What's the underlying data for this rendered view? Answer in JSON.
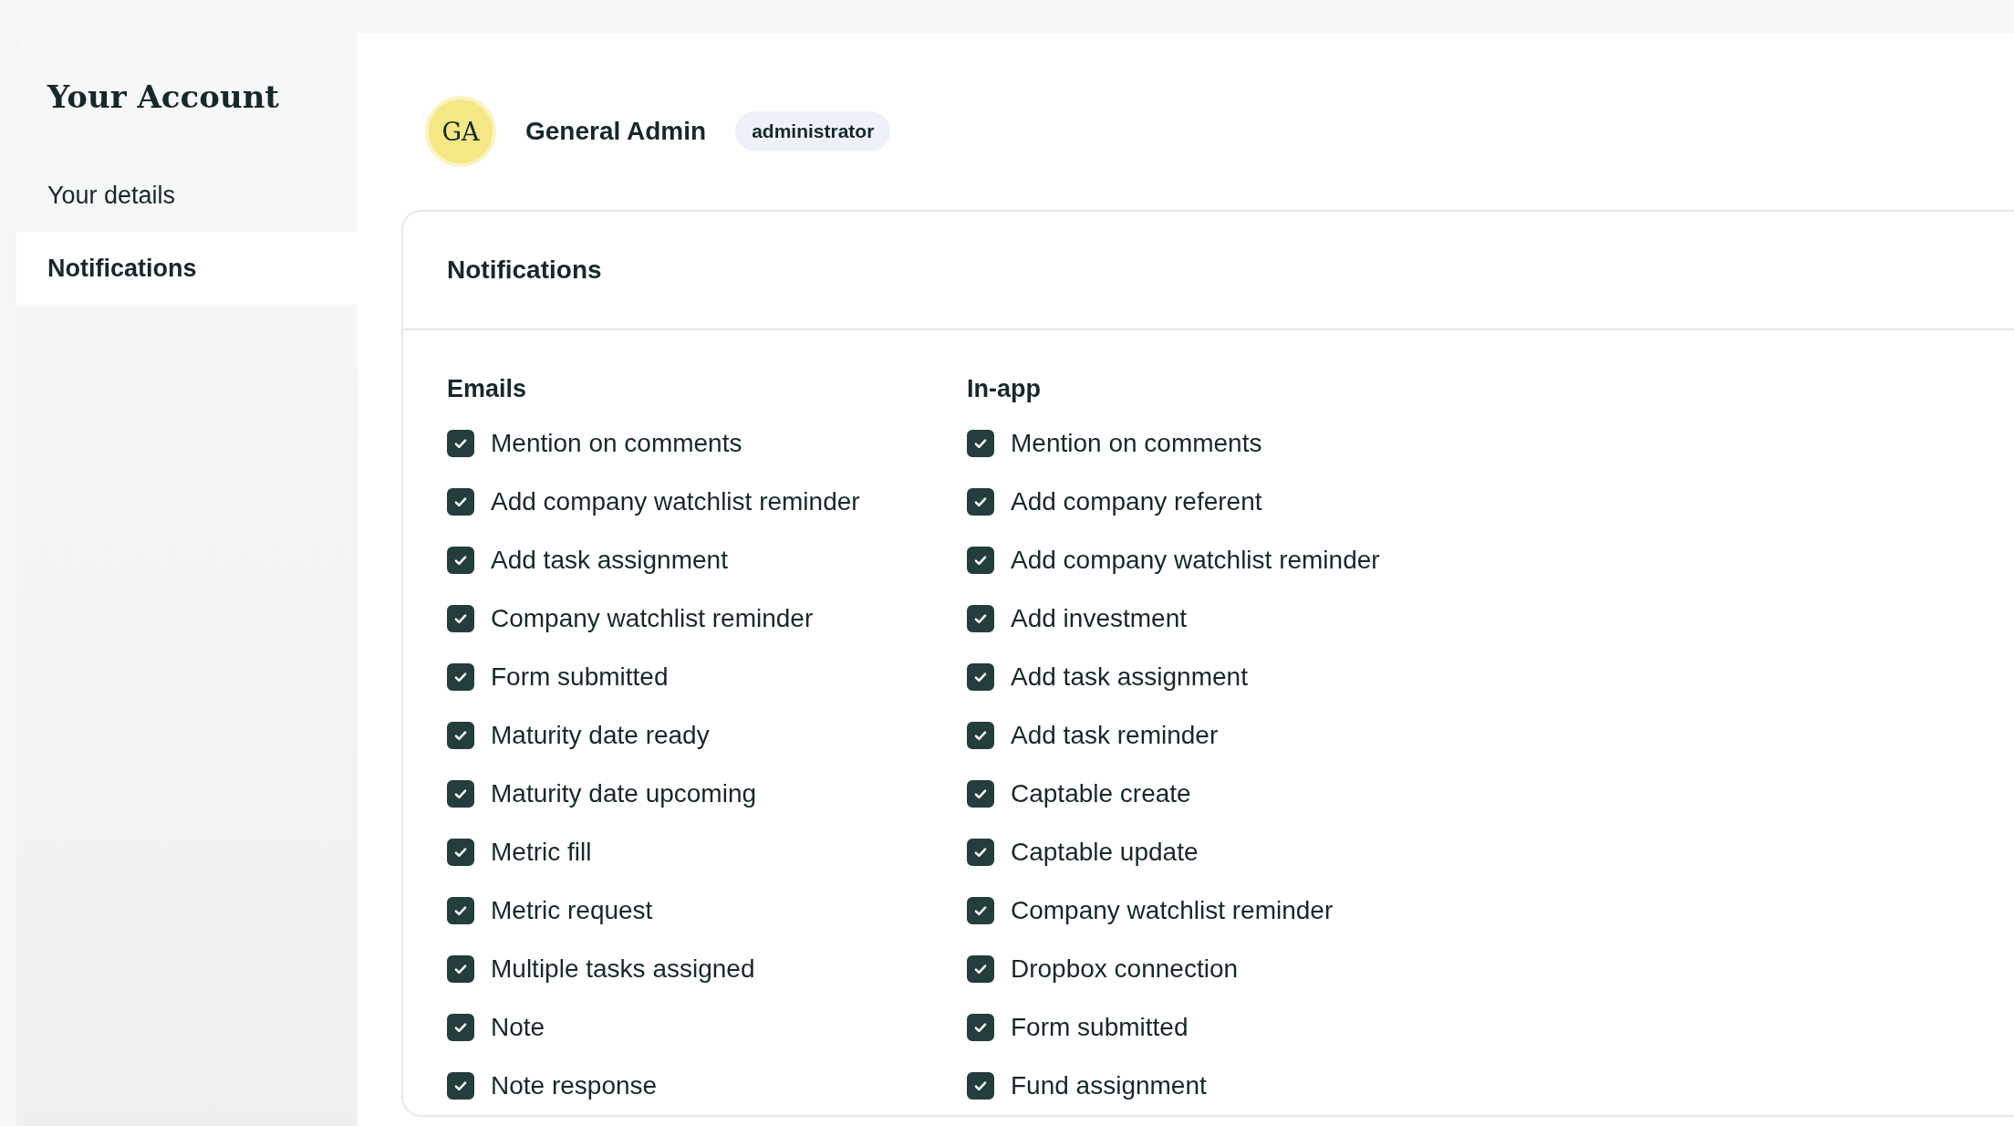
{
  "sidebar": {
    "title": "Your Account",
    "items": [
      {
        "label": "Your details",
        "selected": false
      },
      {
        "label": "Notifications",
        "selected": true
      }
    ]
  },
  "profile": {
    "initials": "GA",
    "name": "General Admin",
    "role": "administrator"
  },
  "card": {
    "title": "Notifications",
    "columns": [
      {
        "heading": "Emails",
        "items": [
          {
            "label": "Mention on comments",
            "checked": true
          },
          {
            "label": "Add company watchlist reminder",
            "checked": true
          },
          {
            "label": "Add task assignment",
            "checked": true
          },
          {
            "label": "Company watchlist reminder",
            "checked": true
          },
          {
            "label": "Form submitted",
            "checked": true
          },
          {
            "label": "Maturity date ready",
            "checked": true
          },
          {
            "label": "Maturity date upcoming",
            "checked": true
          },
          {
            "label": "Metric fill",
            "checked": true
          },
          {
            "label": "Metric request",
            "checked": true
          },
          {
            "label": "Multiple tasks assigned",
            "checked": true
          },
          {
            "label": "Note",
            "checked": true
          },
          {
            "label": "Note response",
            "checked": true
          }
        ]
      },
      {
        "heading": "In-app",
        "items": [
          {
            "label": "Mention on comments",
            "checked": true
          },
          {
            "label": "Add company referent",
            "checked": true
          },
          {
            "label": "Add company watchlist reminder",
            "checked": true
          },
          {
            "label": "Add investment",
            "checked": true
          },
          {
            "label": "Add task assignment",
            "checked": true
          },
          {
            "label": "Add task reminder",
            "checked": true
          },
          {
            "label": "Captable create",
            "checked": true
          },
          {
            "label": "Captable update",
            "checked": true
          },
          {
            "label": "Company watchlist reminder",
            "checked": true
          },
          {
            "label": "Dropbox connection",
            "checked": true
          },
          {
            "label": "Form submitted",
            "checked": true
          },
          {
            "label": "Fund assignment",
            "checked": true
          }
        ]
      }
    ]
  }
}
